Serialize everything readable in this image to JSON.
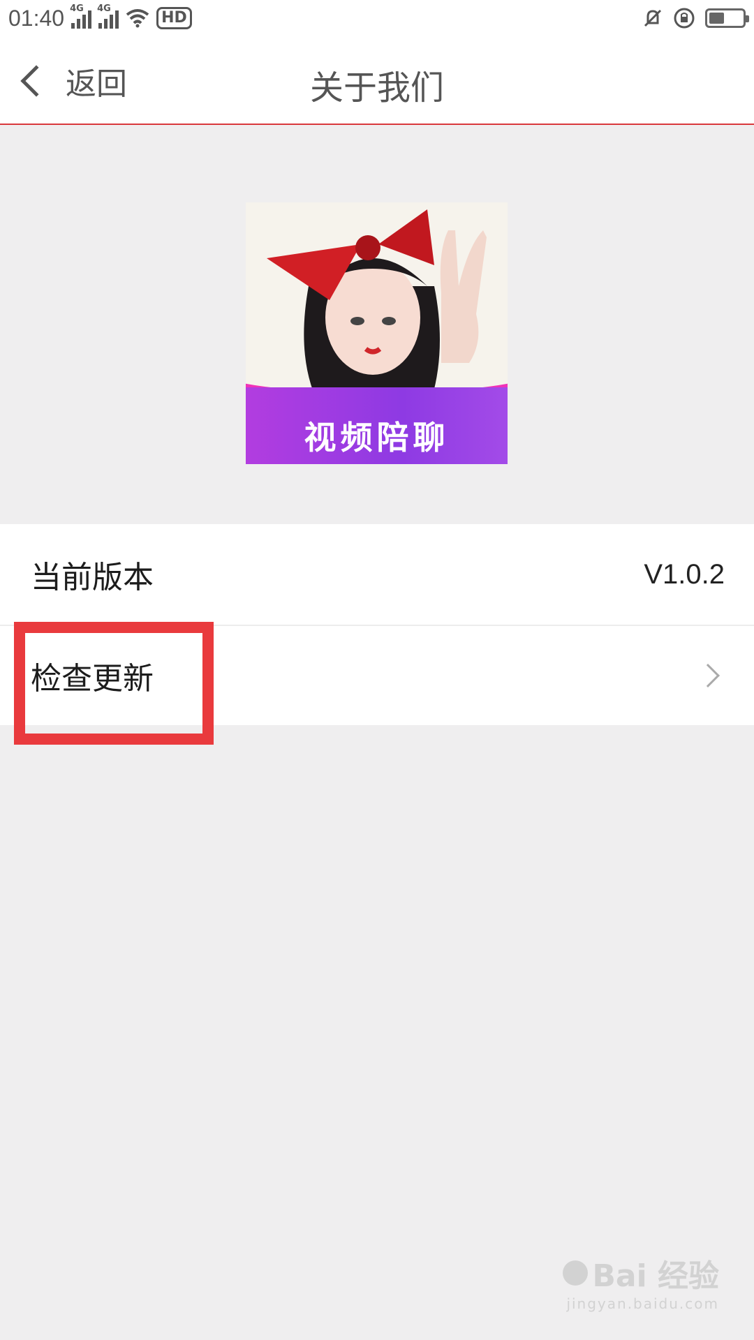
{
  "status_bar": {
    "time": "01:40",
    "network_tags": [
      "4G",
      "4G"
    ],
    "hd_label": "HD",
    "icons": [
      "signal-icon",
      "signal-icon",
      "wifi-icon",
      "hd-icon",
      "mute-icon",
      "rotation-lock-icon",
      "battery-icon"
    ],
    "battery_level": 0.45
  },
  "nav": {
    "back_label": "返回",
    "title": "关于我们"
  },
  "logo": {
    "text": "视频陪聊"
  },
  "list": {
    "version_label": "当前版本",
    "version_value": "V1.0.2",
    "update_label": "检查更新"
  },
  "watermark": {
    "main": "Bai 经验",
    "sub": "jingyan.baidu.com"
  },
  "colors": {
    "accent_line": "#d9383c",
    "highlight": "#e93a3d",
    "background": "#efeeef"
  }
}
